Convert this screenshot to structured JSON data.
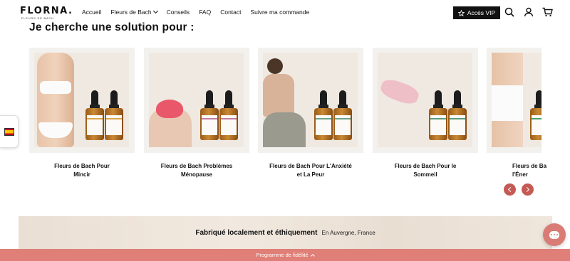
{
  "header": {
    "logo": "FLORNA.",
    "logo_tagline": "FLEURS DE BACH",
    "nav": [
      {
        "label": "Accueil"
      },
      {
        "label": "Fleurs de Bach",
        "has_dropdown": true
      },
      {
        "label": "Conseils"
      },
      {
        "label": "FAQ"
      },
      {
        "label": "Contact"
      },
      {
        "label": "Suivre ma commande"
      }
    ],
    "vip_button": "Accès VIP",
    "icons": [
      "star-icon",
      "search-icon",
      "user-icon",
      "cart-icon"
    ]
  },
  "section": {
    "title": "Je cherche une solution pour :"
  },
  "products": [
    {
      "label_line1": "Fleurs de Bach Pour",
      "label_line2": "Mincir",
      "bottle_label": "PERTE DE POIDS",
      "stripe": "#d9a44b"
    },
    {
      "label_line1": "Fleurs de Bach Problèmes",
      "label_line2": "Ménopause",
      "bottle_label": "MÉNOPAUSE",
      "stripe": "#c07aa0"
    },
    {
      "label_line1": "Fleurs de Bach Pour L'Anxiété",
      "label_line2": "et La Peur",
      "bottle_label": "ANXIÉTÉ",
      "stripe": "#6aa08a"
    },
    {
      "label_line1": "Fleurs de Bach Pour le",
      "label_line2": "Sommeil",
      "bottle_label": "SOMMEIL",
      "stripe": "#5a9a7d"
    },
    {
      "label_line1": "Fleurs de Ba",
      "label_line2": "l'Éner",
      "bottle_label": "ÉNERGIE",
      "stripe": "#4a9c6d"
    }
  ],
  "banner": {
    "title": "Fabriqué localement et éthiquement",
    "subtitle": "En Auvergne, France"
  },
  "loyalty_bar": {
    "label": "Programme de fidélité"
  },
  "colors": {
    "accent": "#c55a55",
    "loyalty_bar": "#e07f77",
    "vip_bg": "#111111"
  }
}
